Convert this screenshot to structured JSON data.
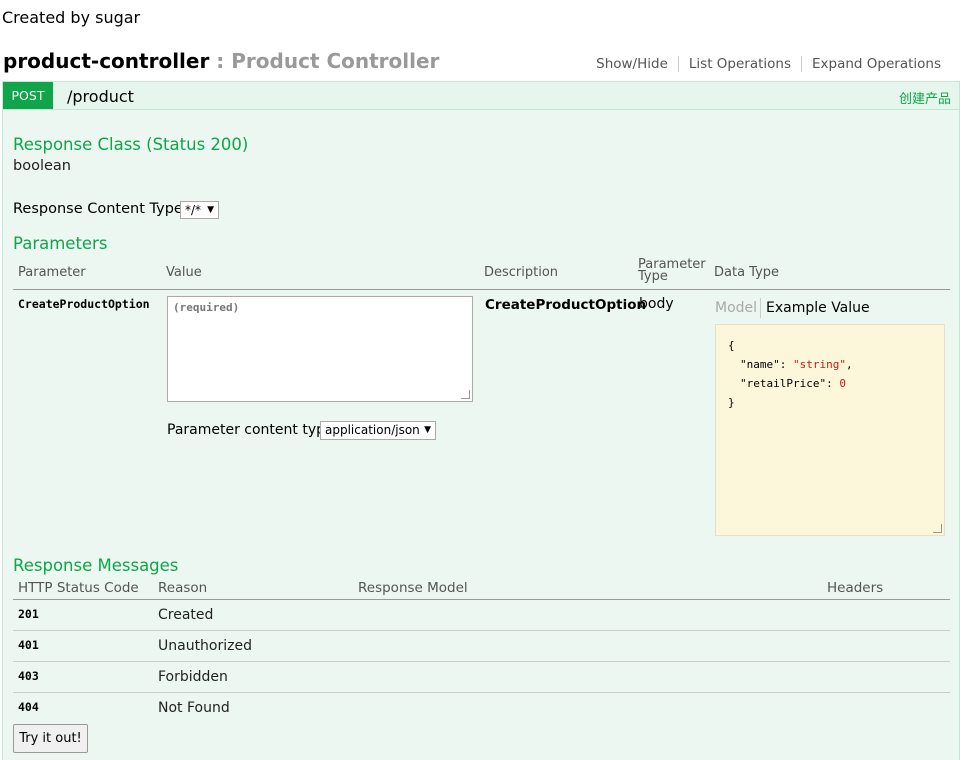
{
  "created_by": "Created by sugar",
  "controller": {
    "name": "product-controller",
    "separator": " : ",
    "description": "Product Controller",
    "links": [
      "Show/Hide",
      "List Operations",
      "Expand Operations"
    ]
  },
  "operation": {
    "method": "POST",
    "path": "/product",
    "summary": "创建产品",
    "colors": {
      "method_bg": "#10a54a",
      "header_bg": "#e7f6ec",
      "body_bg": "#ebf7f0"
    }
  },
  "response_class": {
    "heading": "Response Class (Status 200)",
    "type": "boolean",
    "content_type_label": "Response Content Type",
    "content_type_value": "*/*"
  },
  "parameters": {
    "heading": "Parameters",
    "headers": [
      "Parameter",
      "Value",
      "Description",
      "Parameter Type",
      "Data Type"
    ],
    "rows": [
      {
        "name": "CreateProductOption",
        "value_placeholder": "(required)",
        "description": "CreateProductOption",
        "param_type": "body",
        "model_tab": "Model",
        "example_tab": "Example Value",
        "example_json": {
          "open": "{",
          "line1_key": "\"name\": ",
          "line1_val": "\"string\"",
          "line1_end": ",",
          "line2_key": "\"retailPrice\": ",
          "line2_val": "0",
          "close": "}"
        },
        "content_type_label": "Parameter content type:",
        "content_type_value": "application/json"
      }
    ]
  },
  "response_messages": {
    "heading": "Response Messages",
    "headers": [
      "HTTP Status Code",
      "Reason",
      "Response Model",
      "Headers"
    ],
    "rows": [
      {
        "code": "201",
        "reason": "Created"
      },
      {
        "code": "401",
        "reason": "Unauthorized"
      },
      {
        "code": "403",
        "reason": "Forbidden"
      },
      {
        "code": "404",
        "reason": "Not Found"
      }
    ]
  },
  "try_button": "Try it out!"
}
